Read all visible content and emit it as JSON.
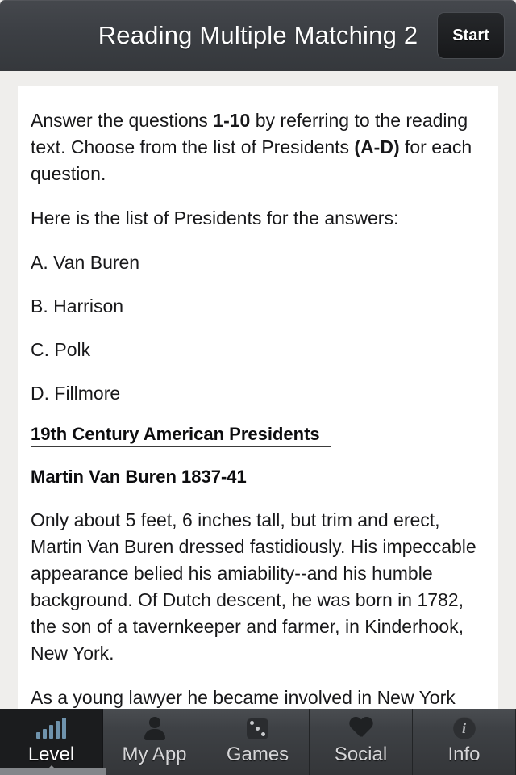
{
  "header": {
    "title": "Reading Multiple Matching 2",
    "start_label": "Start"
  },
  "content": {
    "instructions_part1": "Answer the questions ",
    "instructions_bold1": "1-10",
    "instructions_part2": " by referring to the reading text. Choose from the list of Presidents ",
    "instructions_bold2": "(A-D)",
    "instructions_part3": " for each question.",
    "list_intro": "Here is the list of Presidents for the answers:",
    "answers": [
      "A. Van Buren",
      "B. Harrison",
      "C. Polk",
      "D. Fillmore"
    ],
    "section_title": "19th Century American Presidents",
    "subsection_title": "Martin Van Buren 1837-41",
    "paragraph_1": "Only about 5 feet, 6 inches tall, but trim and erect, Martin Van Buren dressed fastidiously. His impeccable appearance belied his amiability--and his humble background. Of Dutch descent, he was born in 1782, the son of a tavernkeeper and farmer, in Kinderhook, New York.",
    "paragraph_2": "As a young lawyer he became involved in New York politics. As leader of the \"Albany Regency,\" an effective"
  },
  "navbar": {
    "items": [
      {
        "label": "Level",
        "icon": "signal-bars-icon",
        "active": true
      },
      {
        "label": "My App",
        "icon": "person-icon",
        "active": false
      },
      {
        "label": "Games",
        "icon": "dice-icon",
        "active": false
      },
      {
        "label": "Social",
        "icon": "heart-icon",
        "active": false
      },
      {
        "label": "Info",
        "icon": "info-icon",
        "active": false
      }
    ]
  },
  "colors": {
    "header_bg": "#3c3f44",
    "page_bg": "#efeeec",
    "card_bg": "#ffffff",
    "nav_bg": "#3e4145",
    "nav_active_bg": "#1b1c1e",
    "accent_blue": "#6f93ad",
    "text": "#18181a"
  }
}
